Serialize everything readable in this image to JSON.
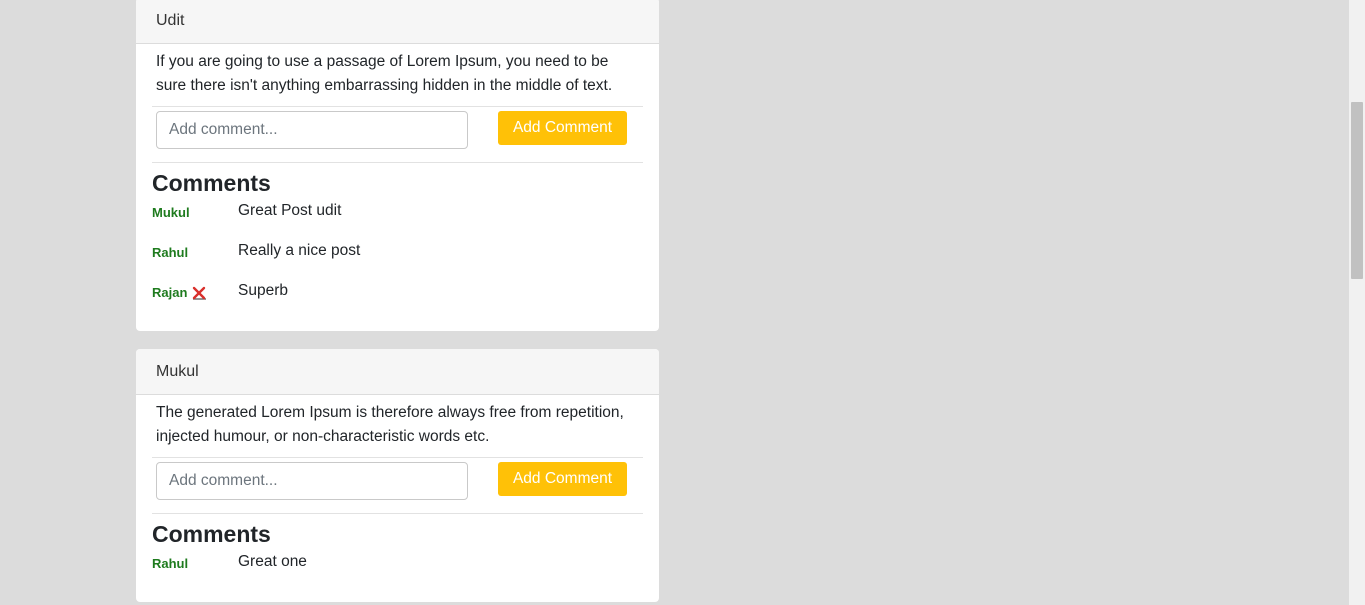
{
  "posts": [
    {
      "author": "Udit",
      "body": "If you are going to use a passage of Lorem Ipsum, you need to be sure there isn't anything embarrassing hidden in the middle of text.",
      "comment_placeholder": "Add comment...",
      "add_button_label": "Add Comment",
      "comments_heading": "Comments",
      "comments": [
        {
          "author": "Mukul",
          "text": "Great Post udit",
          "deletable": false
        },
        {
          "author": "Rahul",
          "text": "Really a nice post",
          "deletable": false
        },
        {
          "author": "Rajan",
          "text": "Superb",
          "deletable": true
        }
      ]
    },
    {
      "author": "Mukul",
      "body": "The generated Lorem Ipsum is therefore always free from repetition, injected humour, or non-characteristic words etc.",
      "comment_placeholder": "Add comment...",
      "add_button_label": "Add Comment",
      "comments_heading": "Comments",
      "comments": [
        {
          "author": "Rahul",
          "text": "Great one",
          "deletable": false
        }
      ]
    }
  ],
  "icons": {
    "delete": "close-icon"
  },
  "colors": {
    "page_background": "#dcdcdc",
    "accent_button": "#ffc107",
    "author_name": "#1e7b1e",
    "delete_icon": "#d9302c"
  }
}
